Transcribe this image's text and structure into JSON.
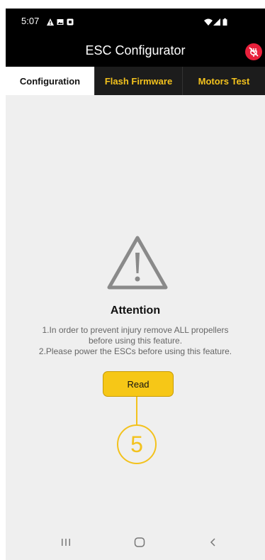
{
  "status_bar": {
    "time": "5:07",
    "left_icons": [
      "alert-icon",
      "image-icon",
      "app-icon"
    ],
    "right_icons": [
      "wifi-icon",
      "signal-icon",
      "battery-icon"
    ]
  },
  "app_bar": {
    "title": "ESC Configurator",
    "disconnect_icon": "usb-disconnect-icon",
    "accent_color": "#e8203b"
  },
  "tabs": [
    {
      "label": "Configuration",
      "active": true
    },
    {
      "label": "Flash Firmware",
      "active": false
    },
    {
      "label": "Motors Test",
      "active": false
    }
  ],
  "main": {
    "warning_icon": "warning-triangle-icon",
    "heading": "Attention",
    "notice_line1": "1.In order to prevent injury remove ALL propellers",
    "notice_line2": "before using this feature.",
    "notice_line3": "2.Please power the ESCs before using this feature.",
    "read_label": "Read",
    "callout_number": "5"
  },
  "colors": {
    "tab_accent": "#f3c21d",
    "button": "#f6c717",
    "background": "#efefef"
  },
  "nav_bar": {
    "items": [
      "recents-icon",
      "home-icon",
      "back-icon"
    ]
  }
}
